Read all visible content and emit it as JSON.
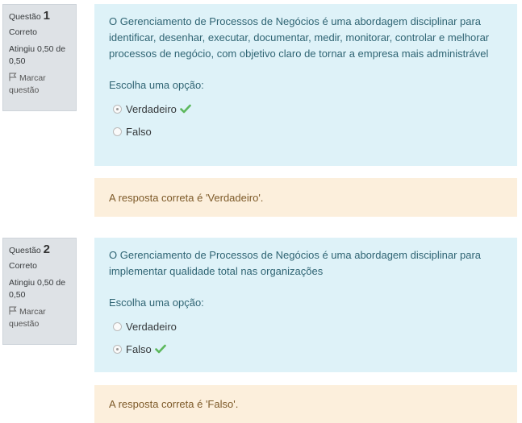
{
  "questions": [
    {
      "label": "Questão",
      "number": "1",
      "state": "Correto",
      "grade": "Atingiu 0,50 de 0,50",
      "flag_label": "Marcar questão",
      "text": "O Gerenciamento de Processos de Negócios é uma abordagem disciplinar para identificar, desenhar, executar, documentar, medir, monitorar, controlar e melhorar processos de negócio, com objetivo claro de tornar a empresa mais administrável",
      "prompt": "Escolha uma opção:",
      "options": [
        {
          "label": "Verdadeiro",
          "selected": true,
          "correct": true
        },
        {
          "label": "Falso",
          "selected": false,
          "correct": false
        }
      ],
      "feedback": "A resposta correta é 'Verdadeiro'."
    },
    {
      "label": "Questão",
      "number": "2",
      "state": "Correto",
      "grade": "Atingiu 0,50 de 0,50",
      "flag_label": "Marcar questão",
      "text": "O Gerenciamento de Processos de Negócios é uma abordagem disciplinar para implementar qualidade total nas organizações",
      "prompt": "Escolha uma opção:",
      "options": [
        {
          "label": "Verdadeiro",
          "selected": false,
          "correct": false
        },
        {
          "label": "Falso",
          "selected": true,
          "correct": true
        }
      ],
      "feedback": "A resposta correta é 'Falso'."
    }
  ],
  "colors": {
    "info_bg": "#dee2e6",
    "formulation_bg": "#def2f8",
    "formulation_text": "#2f6473",
    "feedback_bg": "#fcefdc",
    "feedback_text": "#7d5a29",
    "correct_check": "#5cb85c"
  }
}
